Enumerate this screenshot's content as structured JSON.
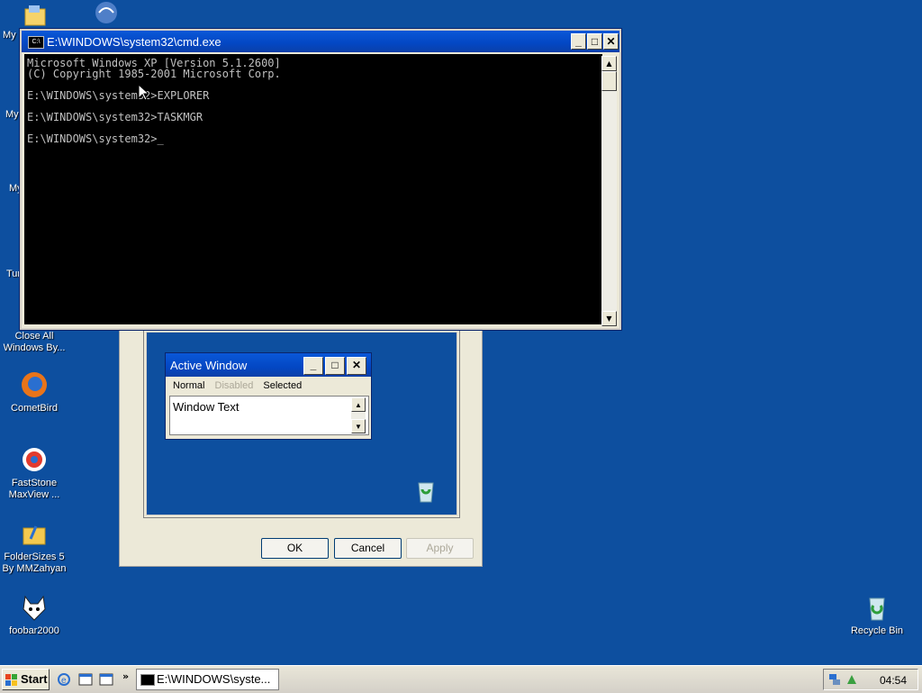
{
  "desktop": {
    "icons_left": [
      {
        "label": "My",
        "partial": true
      },
      {
        "label": "My",
        "partial": true
      },
      {
        "label": "My",
        "partial": true
      },
      {
        "label": "Tur",
        "partial": true
      },
      {
        "label": "Close All Windows By..."
      },
      {
        "label": "CometBird"
      },
      {
        "label": "FastStone MaxView ..."
      },
      {
        "label": "FolderSizes 5 By MMZahyan"
      },
      {
        "label": "foobar2000"
      }
    ],
    "recycle_bin": {
      "label": "Recycle Bin"
    }
  },
  "cmd_window": {
    "title": "E:\\WINDOWS\\system32\\cmd.exe",
    "lines": [
      "Microsoft Windows XP [Version 5.1.2600]",
      "(C) Copyright 1985-2001 Microsoft Corp.",
      "",
      "E:\\WINDOWS\\system32>EXPLORER",
      "",
      "E:\\WINDOWS\\system32>TASKMGR",
      "",
      "E:\\WINDOWS\\system32>_"
    ]
  },
  "dialog": {
    "buttons": {
      "ok": "OK",
      "cancel": "Cancel",
      "apply": "Apply"
    }
  },
  "sample_window": {
    "title": "Active Window",
    "menu": {
      "normal": "Normal",
      "disabled": "Disabled",
      "selected": "Selected"
    },
    "text": "Window Text"
  },
  "taskbar": {
    "start_label": "Start",
    "task_label": "E:\\WINDOWS\\syste...",
    "clock": "04:54"
  }
}
